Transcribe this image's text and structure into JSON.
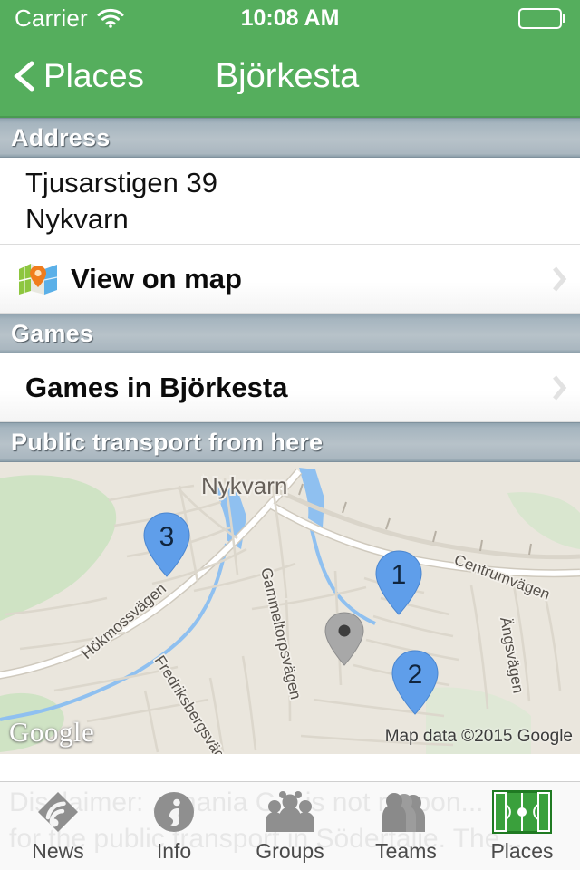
{
  "status_bar": {
    "carrier": "Carrier",
    "wifi_icon": "wifi-icon",
    "time": "10:08 AM",
    "battery_icon": "battery-icon"
  },
  "nav_bar": {
    "back_icon": "chevron-left-icon",
    "back_label": "Places",
    "title": "Björkesta",
    "background_color": "#55ae5d"
  },
  "sections": {
    "address": {
      "header": "Address",
      "line1": "Tjusarstigen 39",
      "line2": "Nykvarn",
      "map_link": {
        "icon": "map-icon",
        "label": "View on map",
        "accessory_icon": "chevron-right-icon"
      }
    },
    "games": {
      "header": "Games",
      "link_label": "Games in Björkesta",
      "accessory_icon": "chevron-right-icon"
    },
    "transport": {
      "header": "Public transport from here"
    }
  },
  "map": {
    "place_label": "Nykvarn",
    "roads": [
      "Hökmossvägen",
      "Fredriksbergsvägen",
      "Gammeltorpsvägen",
      "Centrumvägen",
      "Ängsvägen"
    ],
    "markers": [
      {
        "label": "1",
        "color": "#5f9eea"
      },
      {
        "label": "2",
        "color": "#5f9eea"
      },
      {
        "label": "3",
        "color": "#5f9eea"
      },
      {
        "label": "",
        "color": "#9e9e9e"
      }
    ],
    "watermark": "Google",
    "attribution": "Map data ©2015 Google"
  },
  "disclaimer": {
    "line1": "Disclaimer: ...mania C... is not respon...",
    "line2": "for the public transport in Södertälje. The..."
  },
  "tab_bar": {
    "tabs": [
      {
        "label": "News",
        "icon": "rss-icon",
        "active": false
      },
      {
        "label": "Info",
        "icon": "info-icon",
        "active": false
      },
      {
        "label": "Groups",
        "icon": "groups-icon",
        "active": false
      },
      {
        "label": "Teams",
        "icon": "teams-icon",
        "active": false
      },
      {
        "label": "Places",
        "icon": "pitch-icon",
        "active": true
      }
    ]
  }
}
